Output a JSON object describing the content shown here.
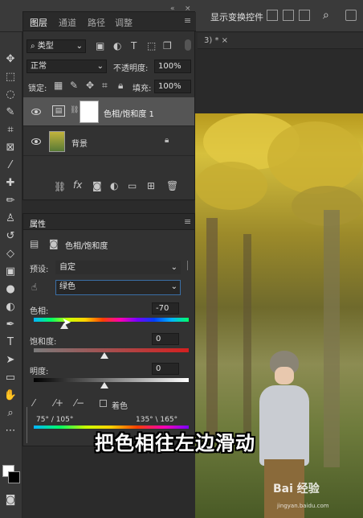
{
  "optbar": {
    "transform_controls_label": "显示变换控件"
  },
  "doc_tab": {
    "label": "3) * ×"
  },
  "layers_panel": {
    "tabs": [
      "图层",
      "通道",
      "路径",
      "调整"
    ],
    "filter_kind": "类型",
    "blend_mode": "正常",
    "opacity_label": "不透明度:",
    "opacity_value": "100%",
    "lock_label": "锁定:",
    "fill_label": "填充:",
    "fill_value": "100%",
    "layers": [
      {
        "name": "色相/饱和度 1"
      },
      {
        "name": "背景"
      }
    ]
  },
  "properties_panel": {
    "title": "属性",
    "adjustment_name": "色相/饱和度",
    "preset_label": "预设:",
    "preset_value": "自定",
    "channel_value": "绿色",
    "hue_label": "色相:",
    "hue_value": "-70",
    "saturation_label": "饱和度:",
    "saturation_value": "0",
    "lightness_label": "明度:",
    "lightness_value": "0",
    "colorize_label": "着色",
    "range_left": "75° / 105°",
    "range_right": "135° \\ 165°"
  },
  "subtitle": "把色相往左边滑动",
  "watermark": {
    "text": "Bai 经验",
    "url": "jingyan.baidu.com"
  },
  "colors": {
    "panel_bg": "#323232",
    "selected_layer": "#555555",
    "accent_field_border": "#3a6ea5"
  }
}
